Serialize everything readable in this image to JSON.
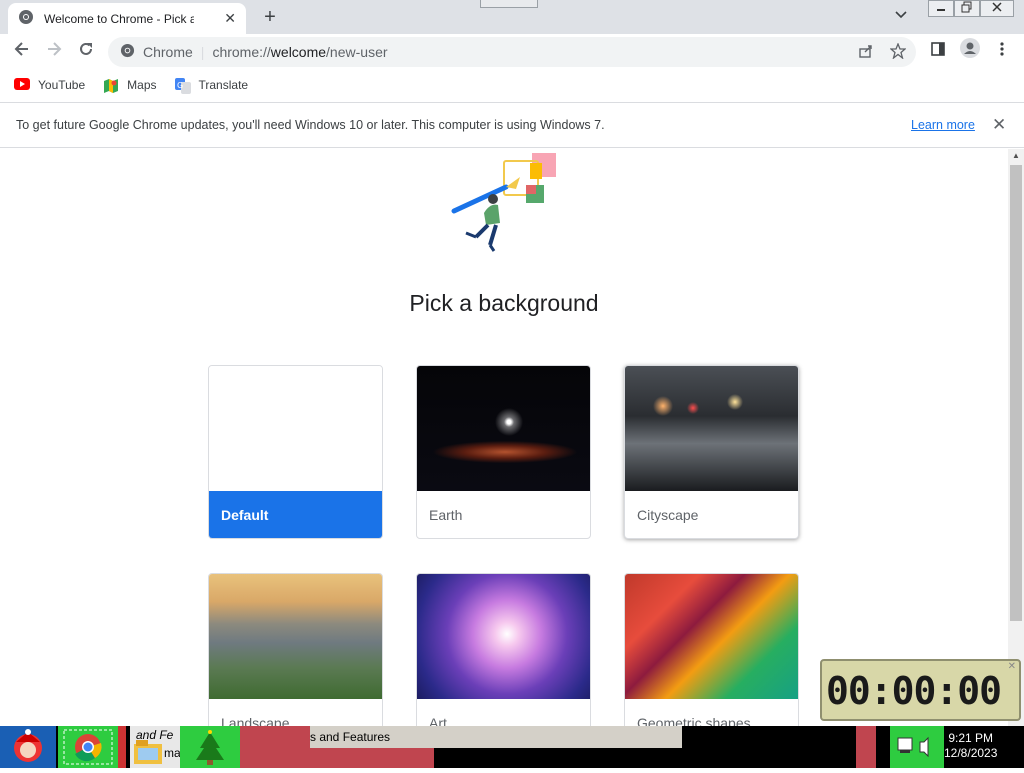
{
  "browser": {
    "tab_title": "Welcome to Chrome - Pick a bac",
    "tab_close": "✕",
    "new_tab": "+",
    "tab_dropdown": "⌄",
    "window_minimize": "▭",
    "window_restore": "⧉",
    "window_close": "✕",
    "omnibox_chip": "Chrome",
    "omnibox_separator": "|",
    "url_prefix": "chrome://",
    "url_host": "welcome",
    "url_path": "/new-user"
  },
  "bookmarks": [
    {
      "label": "YouTube",
      "icon": "youtube-icon",
      "color": "#ff0000"
    },
    {
      "label": "Maps",
      "icon": "maps-icon",
      "color": "#34a853"
    },
    {
      "label": "Translate",
      "icon": "translate-icon",
      "color": "#4285f4"
    }
  ],
  "infobar": {
    "message": "To get future Google Chrome updates, you'll need Windows 10 or later. This computer is using Windows 7.",
    "link": "Learn more",
    "close": "✕"
  },
  "welcome": {
    "heading": "Pick a background",
    "backgrounds": [
      {
        "label": "Default",
        "selected": true
      },
      {
        "label": "Earth",
        "selected": false
      },
      {
        "label": "Cityscape",
        "selected": false
      },
      {
        "label": "Landscape",
        "selected": false
      },
      {
        "label": "Art",
        "selected": false
      },
      {
        "label": "Geometric shapes",
        "selected": false
      }
    ]
  },
  "taskbar": {
    "window_fragment_1": "and Fe",
    "window_fragment_2": "mas",
    "window_title": "s and Features",
    "time": "9:21 PM",
    "date": "12/8/2023"
  },
  "timer": {
    "display": "00:00:00",
    "close": "✕"
  },
  "colors": {
    "accent": "#1a73e8",
    "tabstrip": "#dee1e6"
  }
}
